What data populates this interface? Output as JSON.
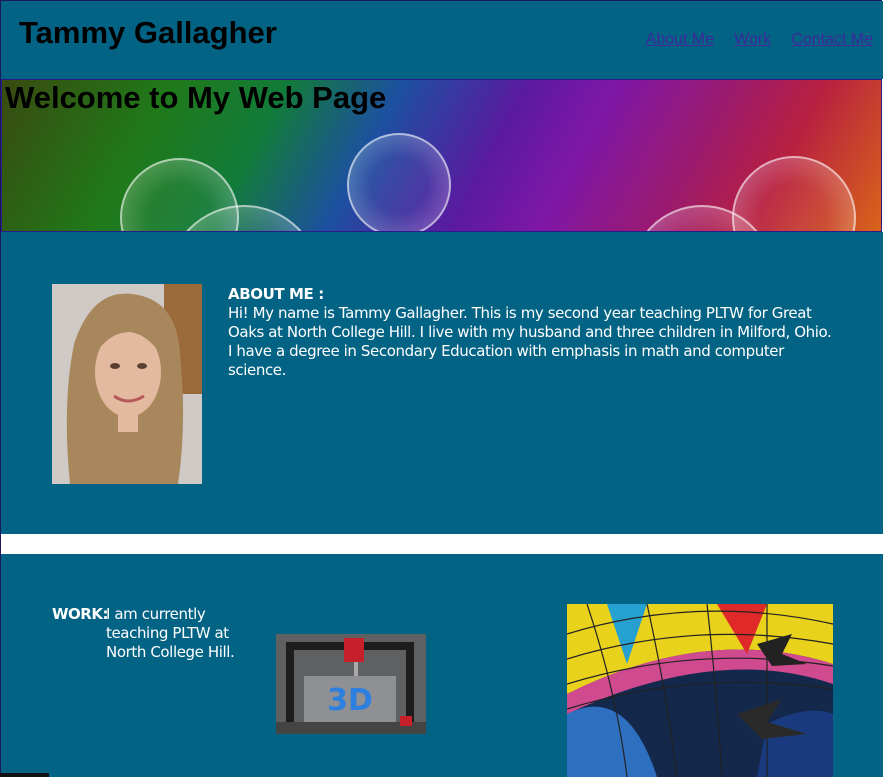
{
  "header": {
    "site_title": "Tammy Gallagher",
    "nav": [
      "About Me",
      "Work",
      "Contact Me"
    ]
  },
  "banner": {
    "heading": "Welcome to My Web Page"
  },
  "about": {
    "title": "ABOUT ME :",
    "body": "Hi! My name is Tammy Gallagher. This is my second year teaching PLTW for Great Oaks at North College Hill. I live with my husband and three children in Milford, Ohio. I have a degree in Secondary Education with emphasis in math and computer science."
  },
  "work": {
    "label": "WORK:",
    "text": "I am currently teaching PLTW at North College Hill."
  },
  "colors": {
    "page_bg": "#036384",
    "nav_link": "#3c2a9a",
    "text": "#ffffff"
  }
}
